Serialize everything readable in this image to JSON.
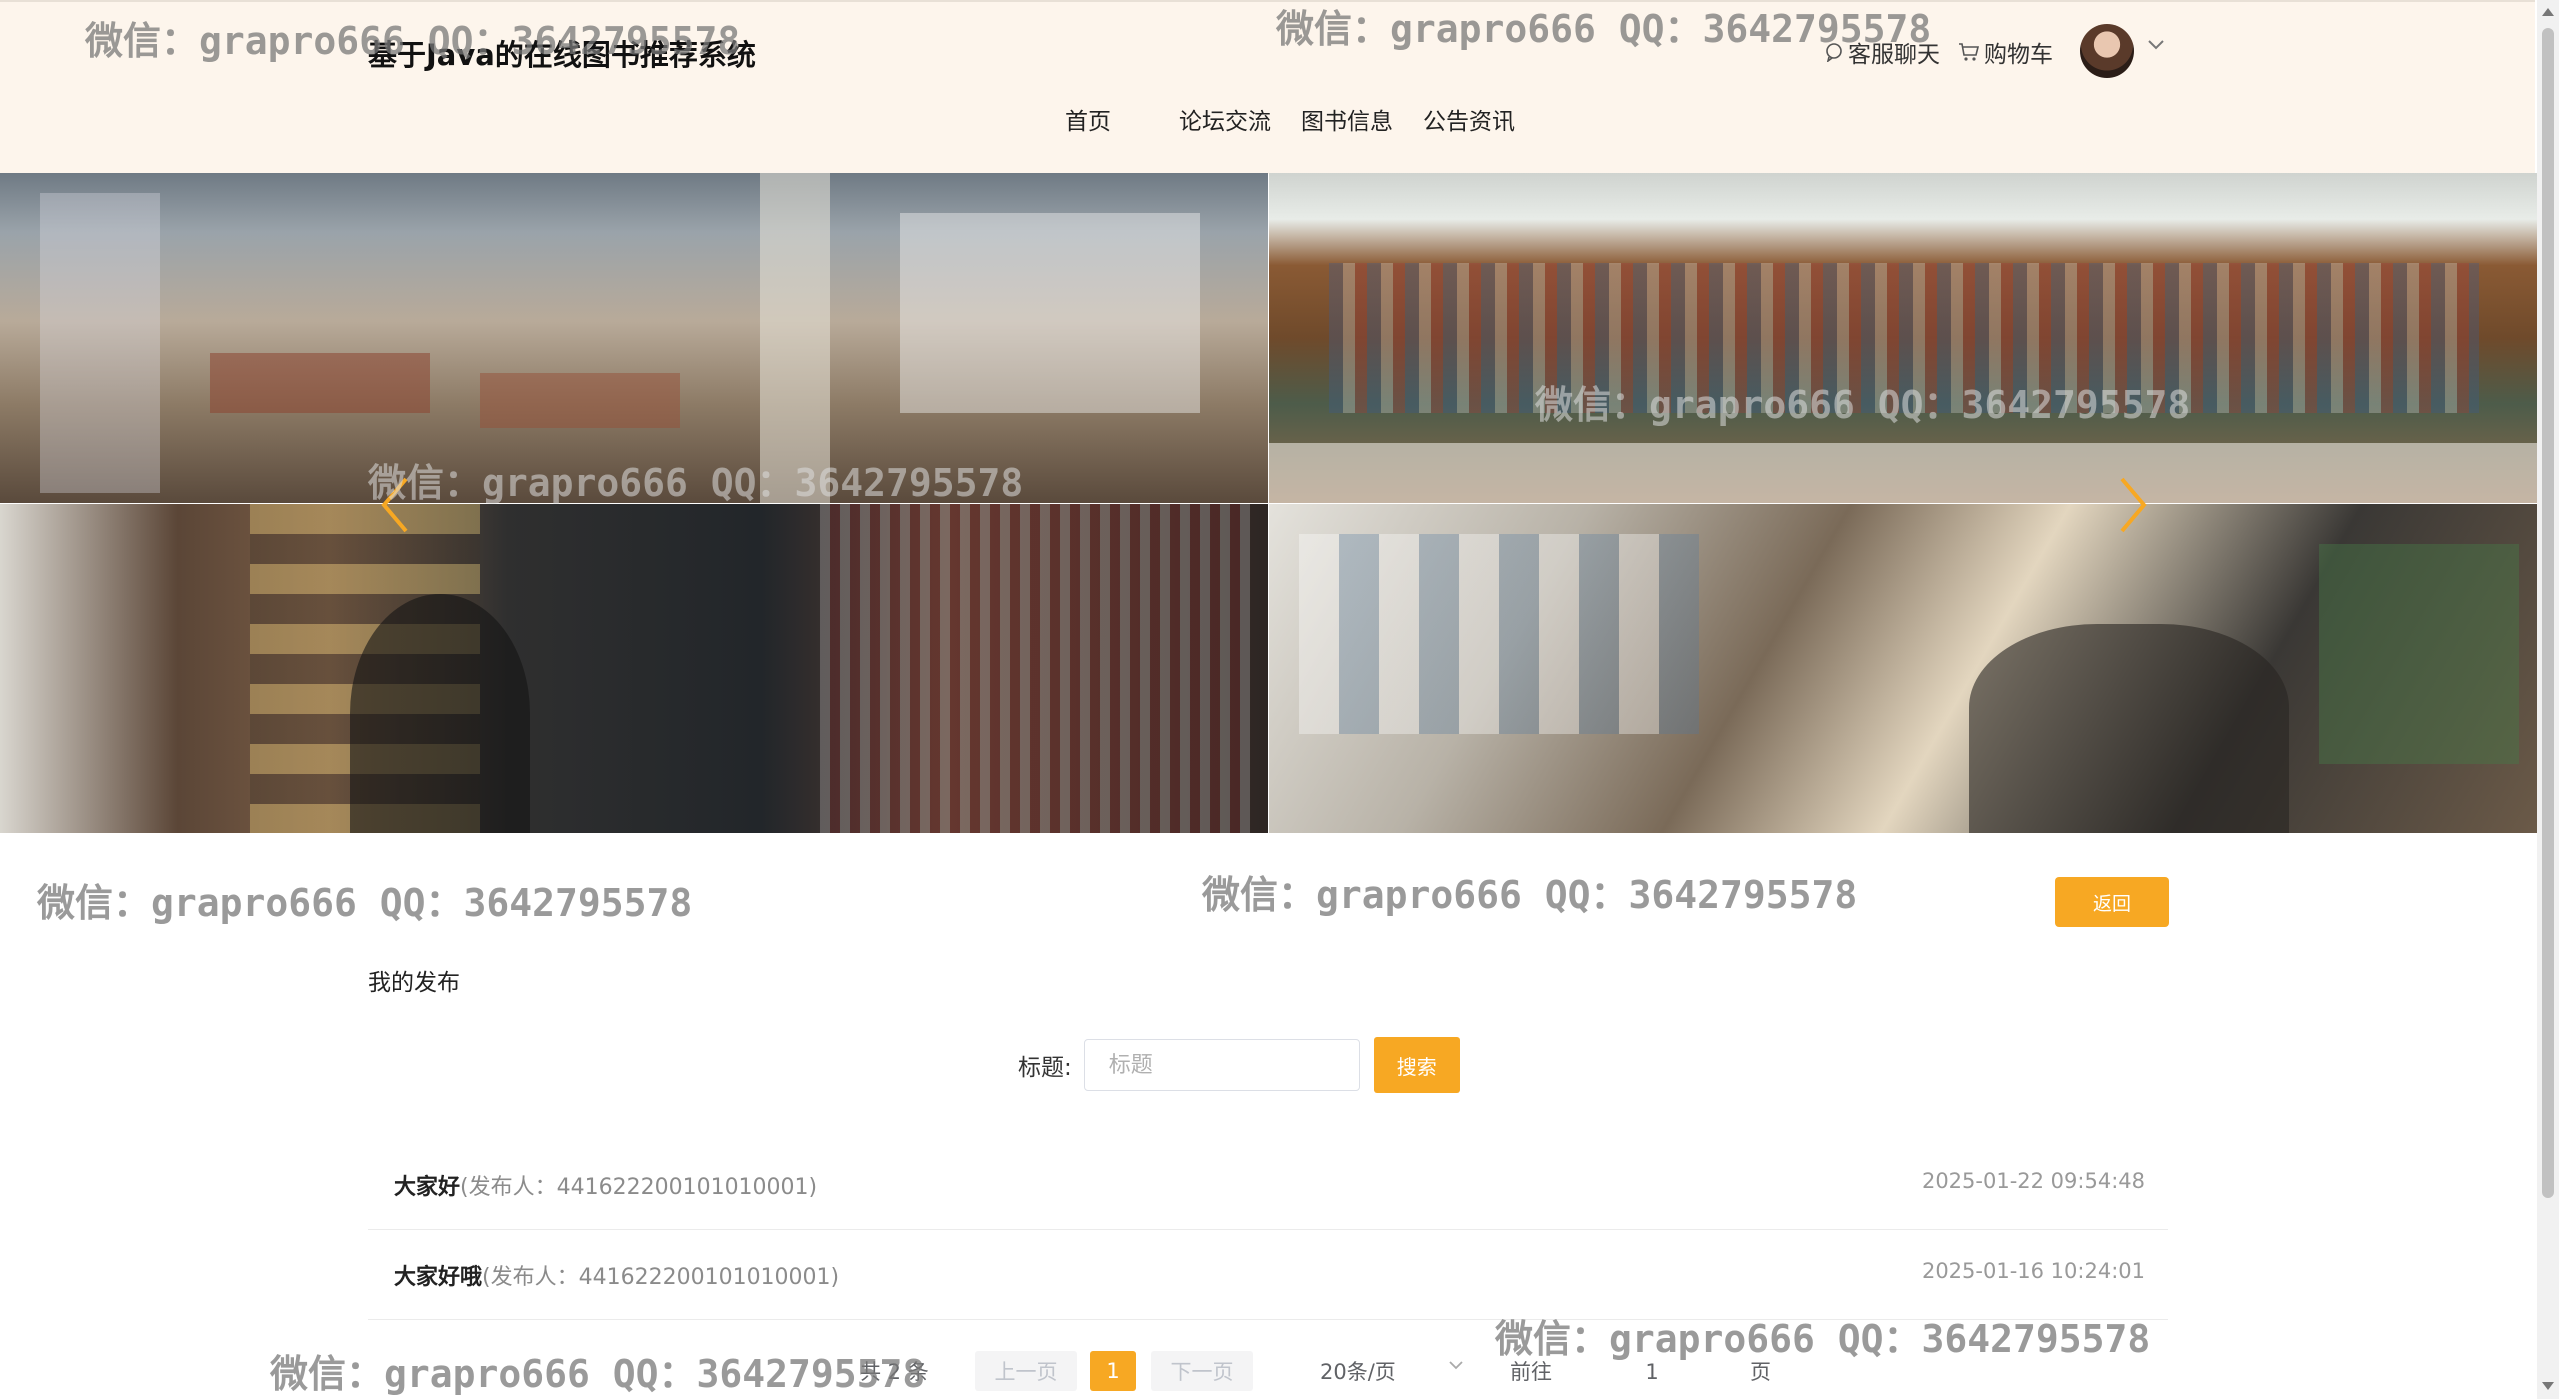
{
  "header": {
    "site_title": "基于Java的在线图书推荐系统",
    "chat_label": "客服聊天",
    "cart_label": "购物车",
    "nav": [
      "首页",
      "论坛交流",
      "图书信息",
      "公告资讯"
    ]
  },
  "banner": {
    "prev_icon": "chevron-left-icon",
    "next_icon": "chevron-right-icon",
    "accent": "#f7a823"
  },
  "content": {
    "back_label": "返回",
    "section_title": "我的发布",
    "search_label": "标题:",
    "search_placeholder": "标题",
    "search_button": "搜索"
  },
  "posts": [
    {
      "title": "大家好",
      "publisher": "(发布人：441622200101010001)",
      "date": "2025-01-22 09:54:48"
    },
    {
      "title": "大家好哦",
      "publisher": "(发布人：441622200101010001)",
      "date": "2025-01-16 10:24:01"
    }
  ],
  "pagination": {
    "total": "共 2 条",
    "prev": "上一页",
    "current": "1",
    "next": "下一页",
    "page_size": "20条/页",
    "goto": "前往",
    "jump_value": "1",
    "page_unit": "页"
  },
  "watermark": "微信：grapro666 QQ：3642795578"
}
